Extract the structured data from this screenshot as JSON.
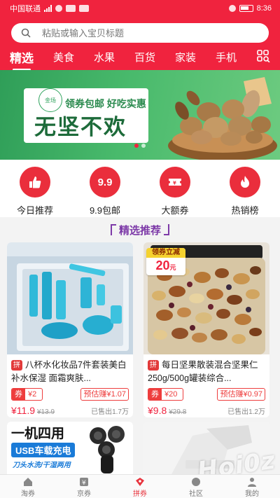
{
  "status_bar": {
    "carrier": "中国联通",
    "time": "8:36"
  },
  "search": {
    "placeholder": "粘贴或输入宝贝标题"
  },
  "tabs": [
    {
      "label": "精选",
      "active": true
    },
    {
      "label": "美食",
      "active": false
    },
    {
      "label": "水果",
      "active": false
    },
    {
      "label": "百货",
      "active": false
    },
    {
      "label": "家装",
      "active": false
    },
    {
      "label": "手机",
      "active": false
    }
  ],
  "banner": {
    "tag": "金场",
    "subtitle": "领券包邮 好吃实惠",
    "title": "无坚不欢"
  },
  "quick_entries": [
    {
      "label": "今日推荐",
      "icon": "thumbs-up-icon"
    },
    {
      "label": "9.9包邮",
      "icon": "9.9"
    },
    {
      "label": "大额券",
      "icon": "ticket-icon"
    },
    {
      "label": "热销榜",
      "icon": "flame-icon"
    }
  ],
  "section": {
    "title": "精选推荐"
  },
  "products": [
    {
      "tag": "拼",
      "title": "八杯水化妆品7件套装美白补水保湿 面霜爽肤...",
      "coupon_label": "券",
      "coupon_value": "¥2",
      "earn": "预估赚¥1.07",
      "price": "¥11.9",
      "old_price": "¥13.9",
      "sold": "已售出1.7万"
    },
    {
      "tag": "拼",
      "title": "每日坚果散装混合坚果仁250g/500g罐装综合...",
      "coupon_label": "券",
      "coupon_value": "¥20",
      "earn": "预估赚¥0.97",
      "price": "¥9.8",
      "old_price": "¥29.8",
      "sold": "已售出1.2万",
      "badge_title": "领券立减",
      "badge_value": "20",
      "badge_unit": "元"
    }
  ],
  "promo": {
    "title": "一机四用",
    "subtitle": "USB车载充电",
    "note": "刀头水洗/干湿两用"
  },
  "bottom_nav": [
    {
      "label": "淘券",
      "icon": "home-icon",
      "active": false
    },
    {
      "label": "京券",
      "icon": "tag-icon",
      "active": false
    },
    {
      "label": "拼券",
      "icon": "coupon-icon",
      "active": true
    },
    {
      "label": "社区",
      "icon": "community-icon",
      "active": false
    },
    {
      "label": "我的",
      "icon": "user-icon",
      "active": false
    }
  ],
  "watermark": "Hoi0z",
  "colors": {
    "brand_red": "#f0233e",
    "banner_green": "#49ba6c",
    "section_purple": "#7d3aa8"
  }
}
